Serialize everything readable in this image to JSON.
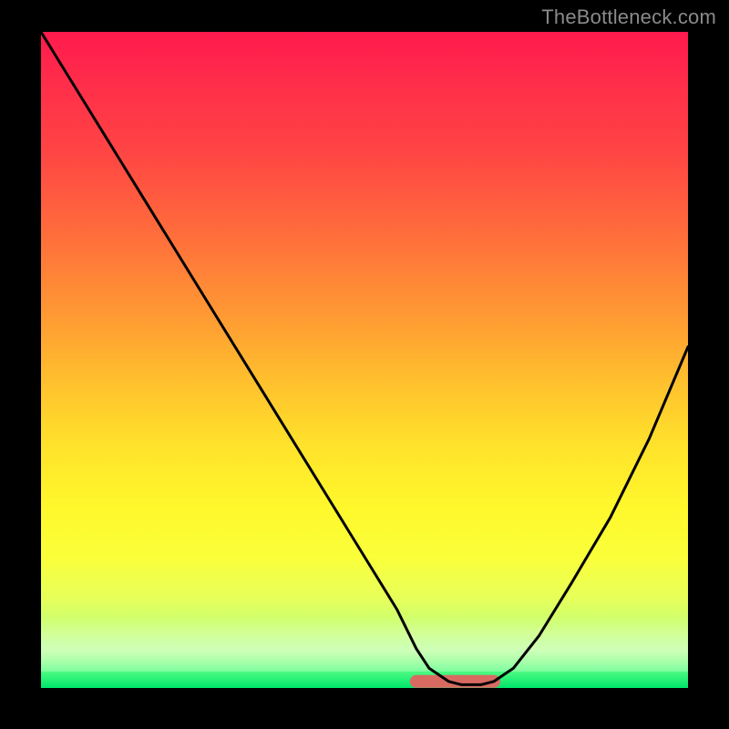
{
  "attribution": "TheBottleneck.com",
  "chart_data": {
    "type": "line",
    "title": "",
    "xlabel": "",
    "ylabel": "",
    "xlim": [
      0,
      100
    ],
    "ylim": [
      0,
      100
    ],
    "grid": false,
    "legend": false,
    "x": [
      0,
      5,
      10,
      15,
      20,
      25,
      30,
      35,
      40,
      45,
      50,
      55,
      58,
      60,
      63,
      65,
      68,
      70,
      73,
      77,
      82,
      88,
      94,
      100
    ],
    "y": [
      100,
      92,
      84,
      76,
      68,
      60,
      52,
      44,
      36,
      28,
      20,
      12,
      6,
      3,
      1,
      0.5,
      0.5,
      1,
      3,
      8,
      16,
      26,
      38,
      52
    ],
    "trough_segment": {
      "x": [
        58,
        70
      ],
      "y": [
        1,
        1
      ]
    },
    "background_gradient": [
      "#ff1a4d",
      "#ffe22b",
      "#00e56b"
    ]
  }
}
